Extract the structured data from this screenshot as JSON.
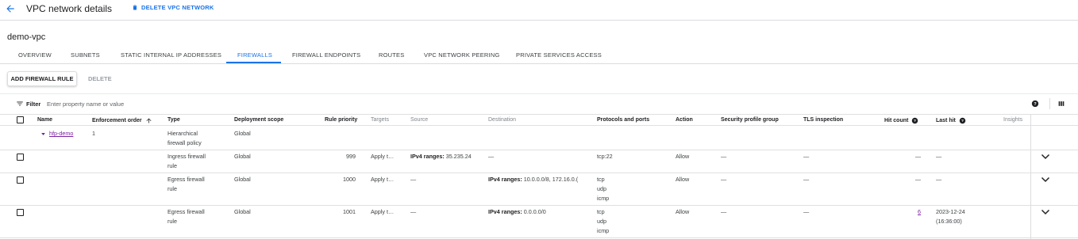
{
  "header": {
    "title": "VPC network details",
    "delete_label": "DELETE VPC NETWORK"
  },
  "resource_name": "demo-vpc",
  "tabs": [
    {
      "label": "OVERVIEW"
    },
    {
      "label": "SUBNETS"
    },
    {
      "label": "STATIC INTERNAL IP ADDRESSES"
    },
    {
      "label": "FIREWALLS"
    },
    {
      "label": "FIREWALL ENDPOINTS"
    },
    {
      "label": "ROUTES"
    },
    {
      "label": "VPC NETWORK PEERING"
    },
    {
      "label": "PRIVATE SERVICES ACCESS"
    }
  ],
  "active_tab": "FIREWALLS",
  "actions": {
    "add_label": "ADD FIREWALL RULE",
    "delete_label": "DELETE"
  },
  "filter": {
    "label": "Filter",
    "placeholder": "Enter property name or value"
  },
  "table": {
    "columns": {
      "name": "Name",
      "enforcement_order": "Enforcement order",
      "type": "Type",
      "deployment_scope": "Deployment scope",
      "rule_priority": "Rule priority",
      "targets": "Targets",
      "source": "Source",
      "destination": "Destination",
      "protocols": "Protocols and ports",
      "action": "Action",
      "security_profile_group": "Security profile group",
      "tls_inspection": "TLS inspection",
      "hit_count": "Hit count",
      "last_hit": "Last hit",
      "insights": "Insights"
    },
    "policy_row": {
      "name": "hfp-demo",
      "enforcement_order": "1",
      "type_line1": "Hierarchical",
      "type_line2": "firewall policy",
      "scope": "Global"
    },
    "rules": [
      {
        "type_line1": "Ingress firewall",
        "type_line2": "rule",
        "scope": "Global",
        "priority": "999",
        "targets": "Apply t…",
        "source_label": "IPv4 ranges:",
        "source_value": "35.235.24",
        "destination": "—",
        "protocols": [
          "tcp:22"
        ],
        "action": "Allow",
        "security_profile_group": "—",
        "tls_inspection": "—",
        "hit_count": "—",
        "last_hit_line1": "—",
        "last_hit_line2": ""
      },
      {
        "type_line1": "Egress firewall",
        "type_line2": "rule",
        "scope": "Global",
        "priority": "1000",
        "targets": "Apply t…",
        "source_value": "—",
        "destination_label": "IPv4 ranges:",
        "destination_value": "10.0.0.0/8, 172.16.0.(",
        "protocols": [
          "tcp",
          "udp",
          "icmp"
        ],
        "action": "Allow",
        "security_profile_group": "—",
        "tls_inspection": "—",
        "hit_count": "—",
        "last_hit_line1": "—",
        "last_hit_line2": ""
      },
      {
        "type_line1": "Egress firewall",
        "type_line2": "rule",
        "scope": "Global",
        "priority": "1001",
        "targets": "Apply t…",
        "source_value": "—",
        "destination_label": "IPv4 ranges:",
        "destination_value": "0.0.0.0/0",
        "protocols": [
          "tcp",
          "udp",
          "icmp"
        ],
        "action": "Allow",
        "security_profile_group": "—",
        "tls_inspection": "—",
        "hit_count": "6",
        "last_hit_line1": "2023-12-24",
        "last_hit_line2": "(16:36:00)"
      }
    ]
  },
  "icons": {
    "back": "arrow-left-icon",
    "delete": "trash-icon",
    "filter": "filter-icon",
    "help": "help-icon",
    "columns": "column-display-icon",
    "sort": "arrow-up-icon",
    "expand": "chevron-down-icon"
  },
  "colors": {
    "accent": "#1a73e8",
    "link": "#7b1fa2",
    "text": "#202124",
    "divider": "#dadce0"
  }
}
